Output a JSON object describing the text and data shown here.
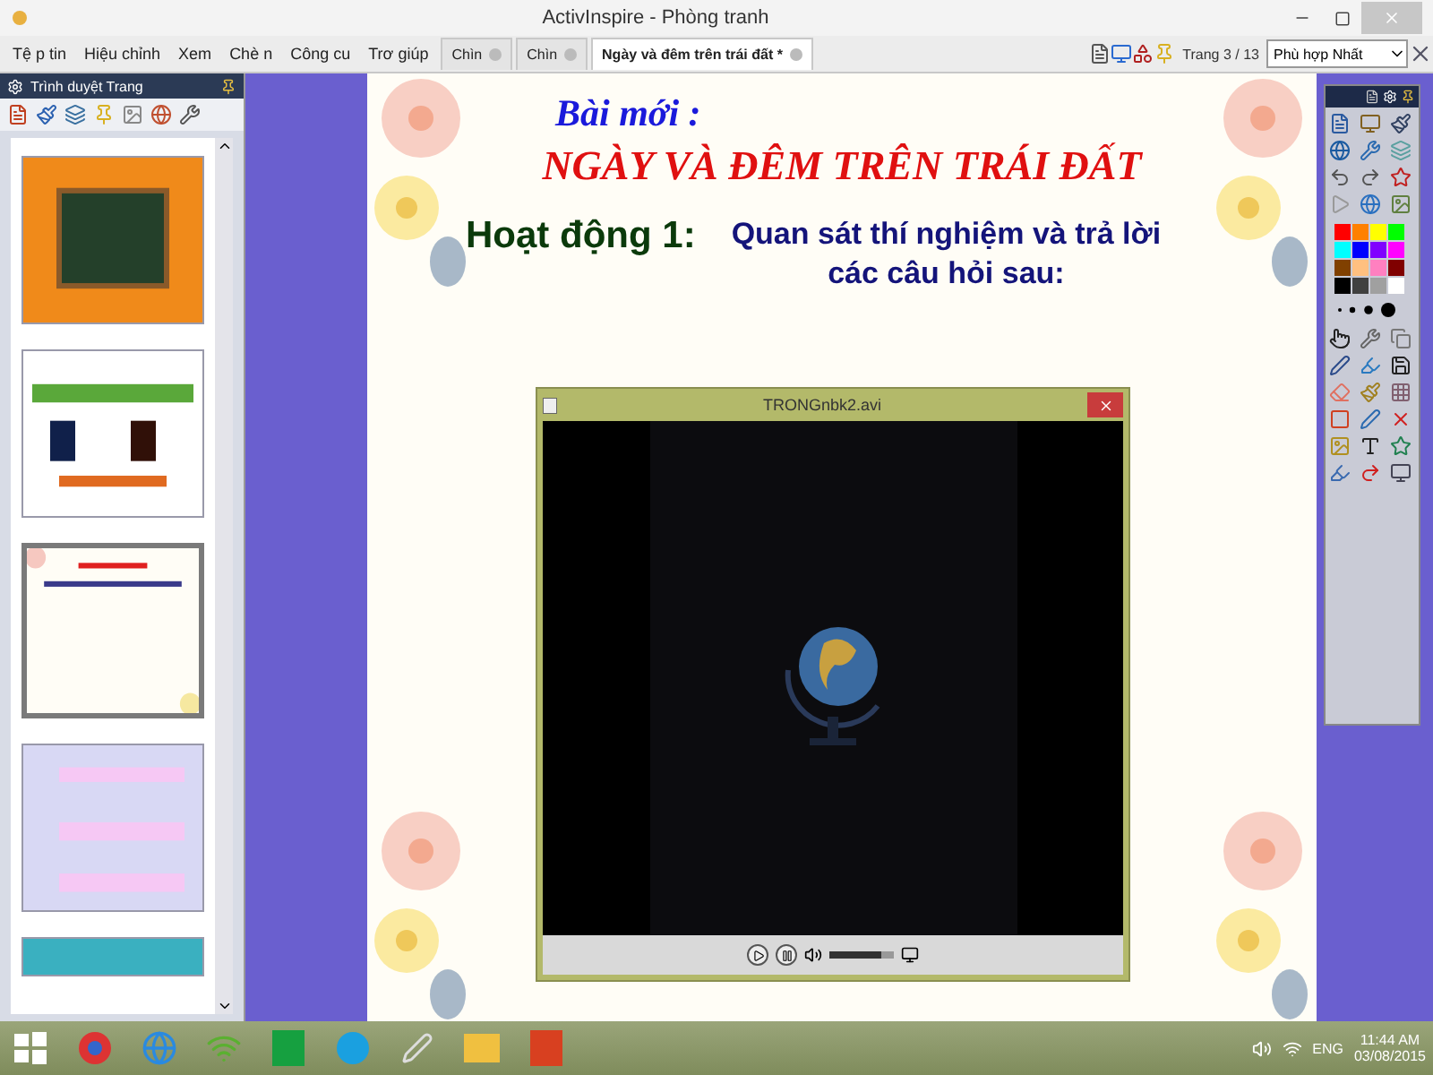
{
  "window": {
    "title": "ActivInspire - Phòng tranh"
  },
  "menu": [
    "Tệ p tin",
    "Hiệu chỉnh",
    "Xem",
    "Chè n",
    "Công cu",
    "Trơ giúp"
  ],
  "tabs": [
    {
      "label": "Chìn",
      "selected": false
    },
    {
      "label": "Chìn",
      "selected": false
    },
    {
      "label": "Ngày và đêm trên trái đất *",
      "selected": true
    }
  ],
  "page_indicator": "Trang 3 / 13",
  "zoom_select": {
    "value": "Phù hợp Nhất"
  },
  "page_browser": {
    "title": "Trình duyệt Trang",
    "pages": [
      {
        "kind": "chalkboard",
        "selected": false
      },
      {
        "kind": "green",
        "selected": false
      },
      {
        "kind": "flowers",
        "selected": true
      },
      {
        "kind": "map",
        "selected": false
      },
      {
        "kind": "banner",
        "selected": false
      }
    ]
  },
  "slide": {
    "subtitle": "Bài mới :",
    "title": "NGÀY VÀ ĐÊM TRÊN TRÁI ĐẤT",
    "activity_label": "Hoạt động 1:",
    "activity_lines": [
      "Quan sát thí nghiệm và trả lời",
      "các câu hỏi sau:"
    ]
  },
  "video_window": {
    "title": "TRONGnbk2.avi",
    "volume": {
      "level": 0.8
    }
  },
  "toolbox": {
    "palette": [
      {
        "color": "#ff0000"
      },
      {
        "color": "#ff8000"
      },
      {
        "color": "#ffff00"
      },
      {
        "color": "#00ff00"
      },
      {
        "color": "#00ffff"
      },
      {
        "color": "#0000ff"
      },
      {
        "color": "#8000ff"
      },
      {
        "color": "#ff00ff"
      },
      {
        "color": "#804000"
      },
      {
        "color": "#ffc080"
      },
      {
        "color": "#ff80c0"
      },
      {
        "color": "#800000"
      },
      {
        "color": "#000000"
      },
      {
        "color": "#404040"
      },
      {
        "color": "#a0a0a0"
      },
      {
        "color": "#ffffff"
      }
    ]
  },
  "taskbar": {
    "language": "ENG",
    "time": "11:44 AM",
    "date": "03/08/2015"
  }
}
